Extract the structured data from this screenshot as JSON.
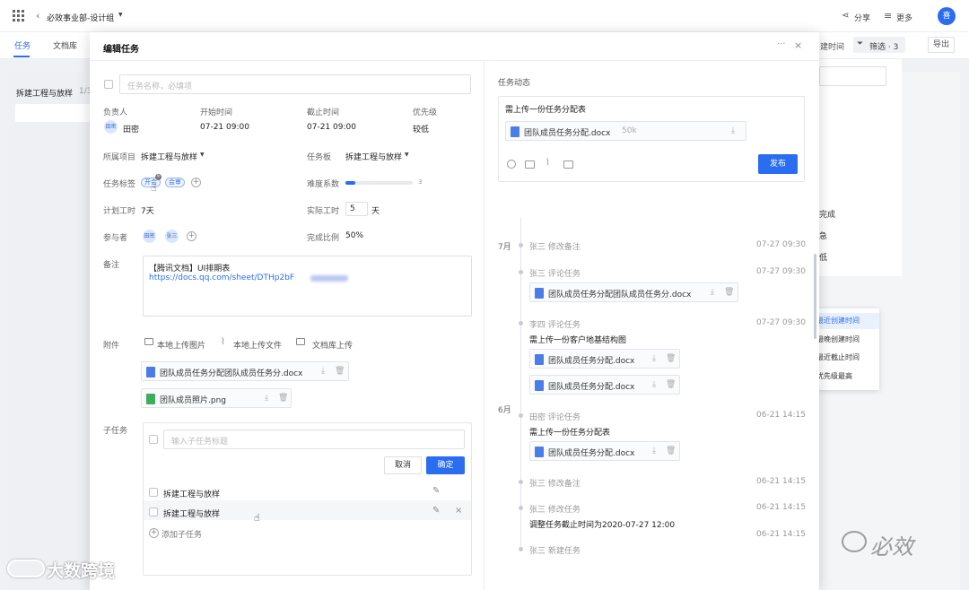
{
  "topbar": {
    "breadcrumb": "必效事业部-设计组",
    "share": "分享",
    "more": "更多",
    "avatar": "喜"
  },
  "tabs": {
    "task": "任务",
    "library": "文档库"
  },
  "background": {
    "column_title": "拆建工程与放样",
    "column_count": "1/3",
    "build_time": "建时间",
    "filter": "筛选 · 3",
    "export": "导出",
    "list_items": [
      "完成",
      "急",
      "低"
    ],
    "sort_options": [
      "最近创建时间",
      "最晚创建时间",
      "最近截止时间",
      "优先级最高"
    ]
  },
  "modal": {
    "title": "编辑任务",
    "task_name_placeholder": "任务名称，必填项",
    "fields": {
      "assignee_label": "负责人",
      "assignee_avatar": "田密",
      "assignee_name": "田密",
      "start_label": "开始时间",
      "start_value": "07-21  09:00",
      "end_label": "截止时间",
      "end_value": "07-21  09:00",
      "priority_label": "优先级",
      "priority_value": "较低",
      "project_label": "所属项目",
      "project_value": "拆建工程与放样",
      "board_label": "任务板",
      "board_value": "拆建工程与放样",
      "tags_label": "任务标签",
      "tags": [
        "开会",
        "会审"
      ],
      "difficulty_label": "难度系数",
      "difficulty_value": "3",
      "difficulty_fraction": 0.15,
      "plan_hours_label": "计划工时",
      "plan_hours_value": "7天",
      "actual_hours_label": "实际工时",
      "actual_hours_value": "5",
      "actual_hours_unit": "天",
      "members_label": "参与者",
      "members": [
        "田密",
        "张三"
      ],
      "completion_label": "完成比例",
      "completion_value": "50%",
      "notes_label": "备注",
      "notes_line1": "【腾讯文档】UI排期表",
      "notes_line2": "https://docs.qq.com/sheet/DTHp2bF",
      "attach_label": "附件",
      "upload_image": "本地上传图片",
      "upload_file": "本地上传文件",
      "upload_library": "文档库上传",
      "attachments": [
        "团队成员任务分配团队成员任务分.docx",
        "团队成员照片.png"
      ],
      "subtask_label": "子任务",
      "subtask_placeholder": "输入子任务标题",
      "cancel": "取消",
      "confirm": "确定",
      "subtasks": [
        "拆建工程与放样",
        "拆建工程与放样"
      ],
      "add_subtask": "添加子任务"
    },
    "activity": {
      "title": "任务动态",
      "composer_text": "需上传一份任务分配表",
      "composer_file": "团队成员任务分配.docx",
      "composer_file_size": "50k",
      "publish": "发布",
      "months": [
        "7月",
        "6月"
      ],
      "events": [
        {
          "actor": "张三 修改备注",
          "time": "07-27 09:30"
        },
        {
          "actor": "张三 评论任务",
          "time": "07-27 09:30",
          "file": "团队成员任务分配团队成员任务分.docx"
        },
        {
          "actor": "李四 评论任务",
          "time": "07-27 09:30",
          "text": "需上传一份客户地基结构图",
          "files": [
            "团队成员任务分配.docx",
            "团队成员任务分配.docx"
          ]
        },
        {
          "actor": "田密 评论任务",
          "time": "06-21 14:15",
          "text": "需上传一份任务分配表",
          "file": "团队成员任务分配.docx"
        },
        {
          "actor": "张三 修改备注",
          "time": "06-21 14:15"
        },
        {
          "actor": "张三 修改任务",
          "time": "06-21 14:15",
          "text": "调整任务截止时间为2020-07-27 12:00"
        },
        {
          "actor": "张三 新建任务",
          "time": "06-21 14:15"
        }
      ]
    }
  },
  "watermarks": {
    "left": "大数跨境",
    "right": "必效"
  },
  "colors": {
    "primary": "#2b6df0",
    "docx_icon": "#4a7de8",
    "png_icon": "#3fae5c"
  }
}
